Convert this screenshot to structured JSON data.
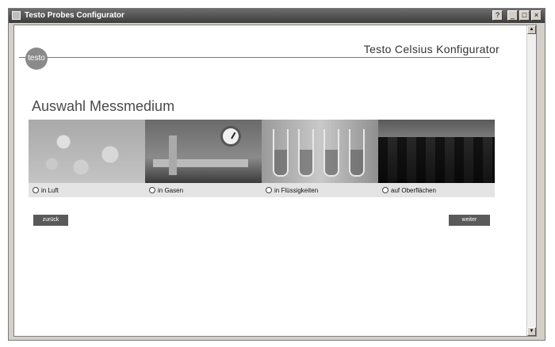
{
  "window": {
    "title": "Testo Probes Configurator",
    "controls": {
      "help": "?",
      "minimize": "_",
      "maximize": "□",
      "close": "×"
    }
  },
  "header": {
    "logo_text": "testo",
    "app_title": "Testo Celsius Konfigurator"
  },
  "main": {
    "heading": "Auswahl Messmedium",
    "media": [
      {
        "label": "in Luft",
        "image": "air-bubbles"
      },
      {
        "label": "in Gasen",
        "image": "gas-pipeline-gauge"
      },
      {
        "label": "in Flüssigkeiten",
        "image": "liquid-test-tubes"
      },
      {
        "label": "auf Oberflächen",
        "image": "steel-coils-surface"
      }
    ],
    "back_button": "zurück",
    "next_button": "weiter"
  },
  "scrollbar": {
    "up": "▲",
    "down": "▼"
  }
}
